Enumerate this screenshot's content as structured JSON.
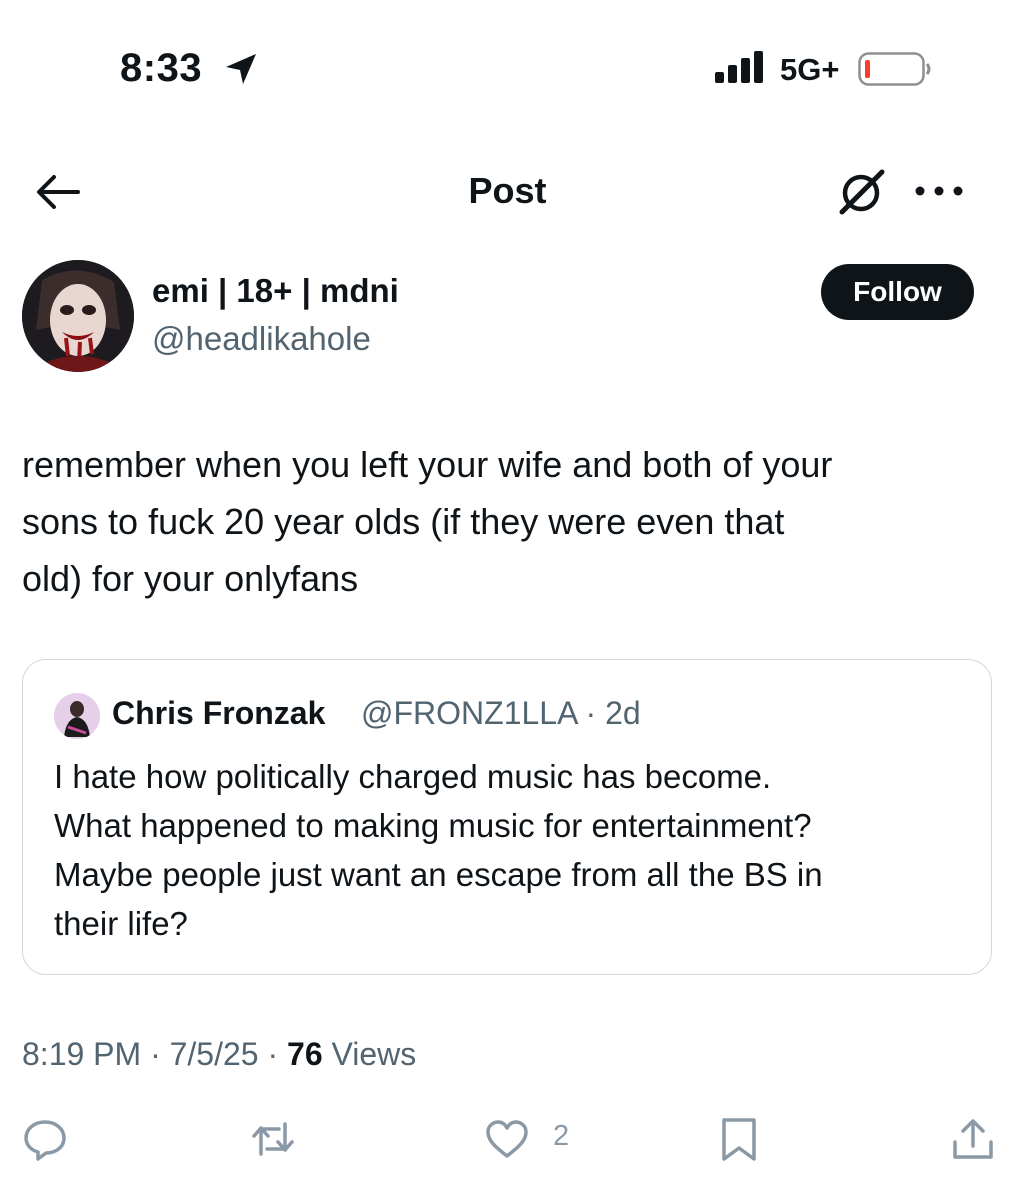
{
  "status_bar": {
    "time": "8:33",
    "network": "5G+",
    "icons": [
      "location-arrow-icon",
      "signal-bars-icon",
      "battery-low-icon"
    ]
  },
  "header": {
    "title": "Post",
    "icons": [
      "back-arrow-icon",
      "grok-icon",
      "more-icon"
    ]
  },
  "author": {
    "display_name": "emi | 18+ | mdni",
    "handle": "@headlikahole",
    "follow_label": "Follow"
  },
  "post": {
    "lines": [
      "remember when you left your wife and both of your",
      "sons to fuck 20 year olds (if they were even that",
      "old) for your onlyfans"
    ]
  },
  "quote": {
    "name": "Chris Fronzak",
    "handle_time": "@FRONZ1LLA · 2d",
    "lines": [
      "I hate how politically charged music has become.",
      "What happened to making music for entertainment?",
      "Maybe people just want an escape from all the BS in",
      "their life?"
    ]
  },
  "meta": {
    "time": "8:19 PM",
    "sep1": " · ",
    "date": "7/5/25",
    "sep2": " · ",
    "views_count": "76",
    "views_label": " Views"
  },
  "actions": {
    "like_count": "2",
    "icons": [
      "reply-icon",
      "retweet-icon",
      "like-icon",
      "bookmark-icon",
      "share-icon"
    ]
  },
  "colors": {
    "text": "#0f1419",
    "secondary": "#536471",
    "action_gray": "#8b98a5",
    "border": "#cfd9de",
    "follow_bg": "#0f1419",
    "battery_red": "#ff3b30"
  }
}
